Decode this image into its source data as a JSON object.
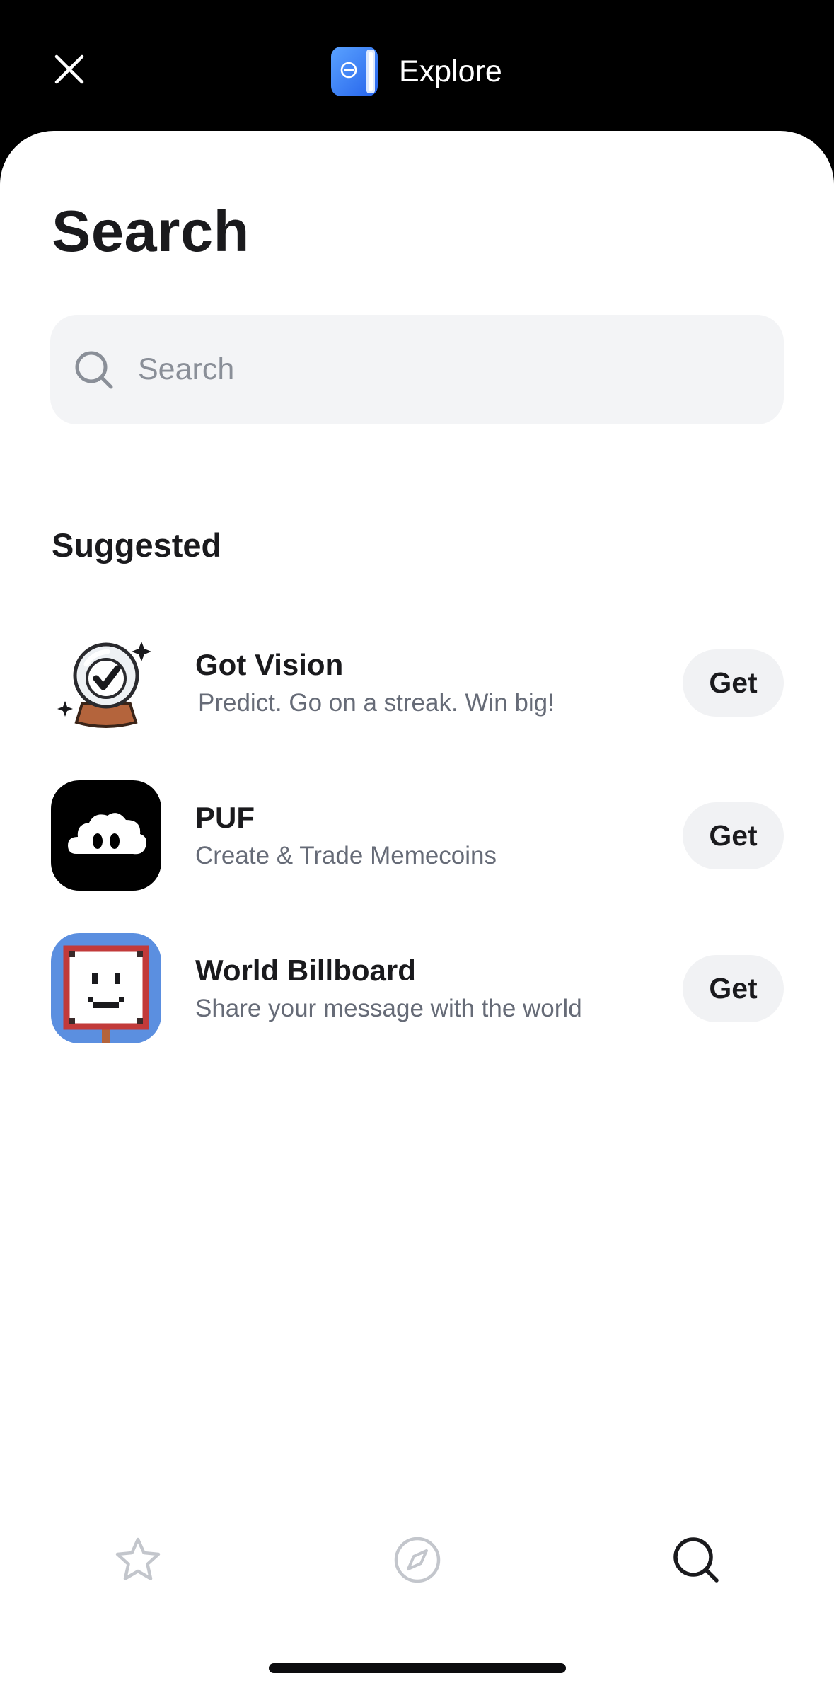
{
  "header": {
    "title": "Explore",
    "close_icon": "close-icon",
    "logo_icon": "explore-app-logo"
  },
  "page": {
    "title": "Search"
  },
  "search": {
    "placeholder": "Search",
    "icon": "search-icon"
  },
  "suggested": {
    "title": "Suggested",
    "items": [
      {
        "name": "Got Vision",
        "description": "Predict. Go on a streak. Win big!",
        "action": "Get",
        "icon": "crystal-ball-check-icon"
      },
      {
        "name": "PUF",
        "description": "Create & Trade Memecoins",
        "action": "Get",
        "icon": "puf-cloud-icon"
      },
      {
        "name": "World Billboard",
        "description": "Share your message with the world",
        "action": "Get",
        "icon": "billboard-smiley-icon"
      }
    ]
  },
  "tabbar": {
    "tabs": [
      {
        "name": "favorites",
        "icon": "star-icon",
        "active": false
      },
      {
        "name": "explore",
        "icon": "compass-icon",
        "active": false
      },
      {
        "name": "search",
        "icon": "search-icon",
        "active": true
      }
    ]
  },
  "colors": {
    "header_bg": "#000000",
    "sheet_bg": "#ffffff",
    "search_bg": "#f3f4f6",
    "button_bg": "#f1f2f4",
    "text_primary": "#1a1a1d",
    "text_secondary": "#666b77",
    "tab_inactive": "#c3c6cc",
    "accent_blue": "#3b82f6"
  }
}
